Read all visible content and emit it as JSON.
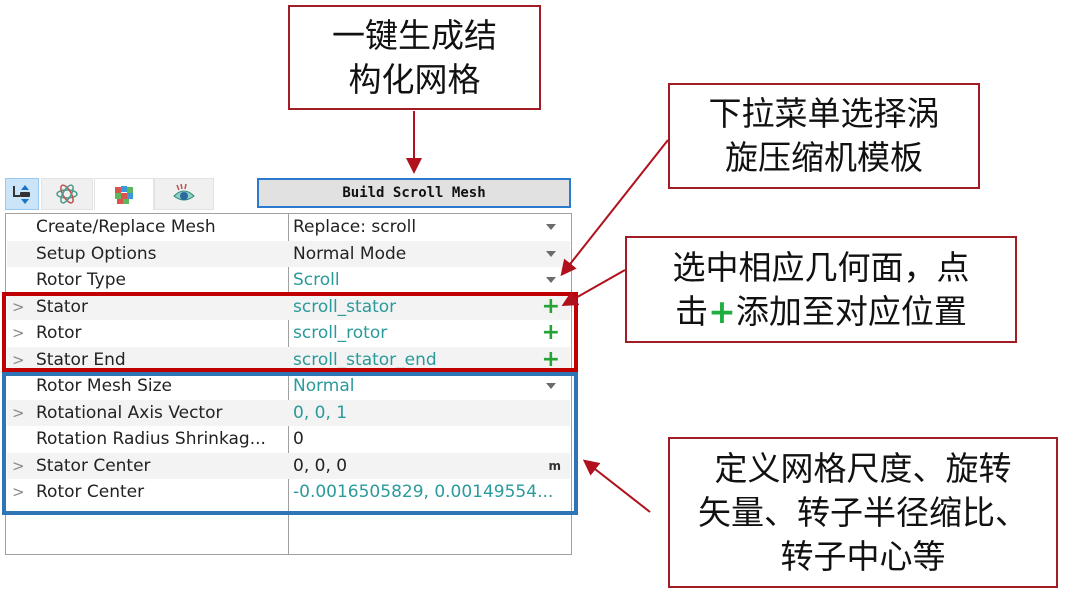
{
  "toolbar": {
    "tabs": [
      {
        "icon": "mesh-tool-icon",
        "state": "selected"
      },
      {
        "icon": "atom-icon",
        "state": "normal"
      },
      {
        "icon": "cube-icon",
        "state": "active"
      },
      {
        "icon": "eye-icon",
        "state": "normal"
      }
    ],
    "build_button_label": "Build Scroll Mesh"
  },
  "properties": [
    {
      "name": "Create/Replace Mesh",
      "value": "Replace: scroll",
      "control": "dropdown",
      "expandable": false,
      "value_color": "default"
    },
    {
      "name": "Setup Options",
      "value": "Normal Mode",
      "control": "dropdown",
      "expandable": false,
      "value_color": "default"
    },
    {
      "name": "Rotor Type",
      "value": "Scroll",
      "control": "dropdown",
      "expandable": false,
      "value_color": "teal"
    },
    {
      "name": "Stator",
      "value": "scroll_stator",
      "control": "add",
      "expandable": true,
      "value_color": "teal"
    },
    {
      "name": "Rotor",
      "value": "scroll_rotor",
      "control": "add",
      "expandable": true,
      "value_color": "teal"
    },
    {
      "name": "Stator End",
      "value": "scroll_stator_end",
      "control": "add",
      "expandable": true,
      "value_color": "teal"
    },
    {
      "name": "Rotor Mesh Size",
      "value": "Normal",
      "control": "dropdown",
      "expandable": false,
      "value_color": "teal"
    },
    {
      "name": "Rotational Axis Vector",
      "value": "0, 0, 1",
      "control": "none",
      "expandable": true,
      "value_color": "teal"
    },
    {
      "name": "Rotation Radius Shrinkag...",
      "value": "0",
      "control": "none",
      "expandable": false,
      "value_color": "default"
    },
    {
      "name": "Stator Center",
      "value": "0, 0, 0",
      "control": "unit",
      "unit": "m",
      "expandable": true,
      "value_color": "default"
    },
    {
      "name": "Rotor Center",
      "value": "-0.0016505829, 0.00149554...",
      "control": "none",
      "expandable": true,
      "value_color": "teal"
    }
  ],
  "callouts": {
    "build": {
      "lines": [
        "一键生成结",
        "构化网格"
      ]
    },
    "template": {
      "lines": [
        "下拉菜单选择涡",
        "旋压缩机模板"
      ]
    },
    "add_faces": {
      "line1": "选中相应几何面，点",
      "line2_prefix": "击",
      "line2_plus": "+",
      "line2_suffix": "添加至对应位置"
    },
    "params": {
      "lines": [
        "定义网格尺度、旋转",
        "矢量、转子半径缩比、",
        "转子中心等"
      ]
    }
  },
  "colors": {
    "highlight_red": "#c00000",
    "highlight_blue": "#2e75b6",
    "callout_border": "#a01d26",
    "teal_value": "#2a9a9a",
    "add_green": "#25a336"
  }
}
